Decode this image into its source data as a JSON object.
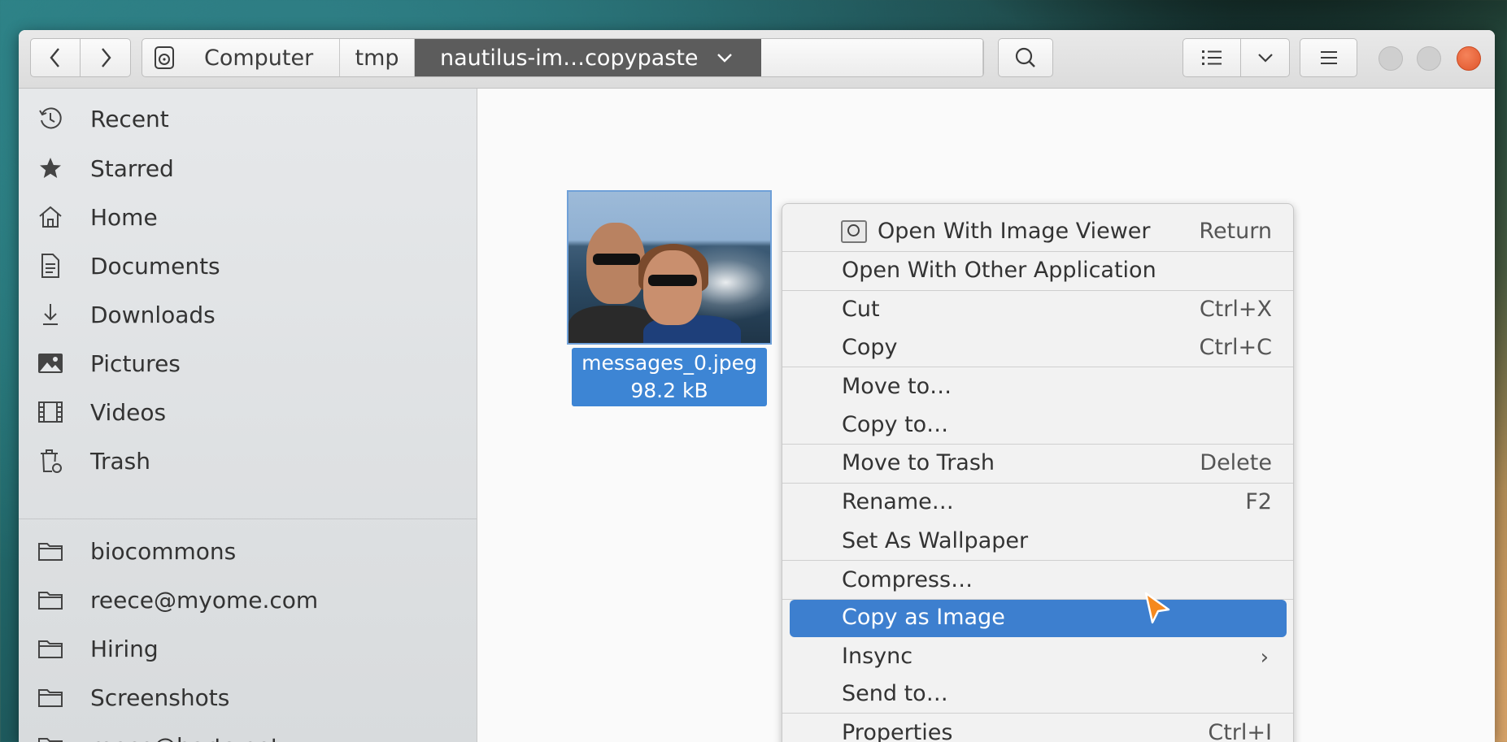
{
  "headerbar": {
    "back_icon": "chevron-left-icon",
    "forward_icon": "chevron-right-icon",
    "path": {
      "root_label": "Computer",
      "root_icon": "disk-icon",
      "crumbs": [
        "tmp"
      ],
      "current": "nautilus-im…copypaste",
      "current_icon": "chevron-down-icon"
    },
    "search_icon": "search-icon",
    "view_icon": "list-view-icon",
    "view_options_icon": "chevron-down-icon",
    "menu_icon": "hamburger-icon",
    "close_color": "#e0552b"
  },
  "sidebar": {
    "places": [
      {
        "label": "Recent",
        "icon": "clock-icon"
      },
      {
        "label": "Starred",
        "icon": "star-icon"
      },
      {
        "label": "Home",
        "icon": "home-icon"
      },
      {
        "label": "Documents",
        "icon": "document-icon"
      },
      {
        "label": "Downloads",
        "icon": "download-icon"
      },
      {
        "label": "Pictures",
        "icon": "pictures-icon"
      },
      {
        "label": "Videos",
        "icon": "video-icon"
      },
      {
        "label": "Trash",
        "icon": "trash-icon"
      }
    ],
    "bookmarks": [
      {
        "label": "biocommons",
        "icon": "folder-icon"
      },
      {
        "label": "reece@myome.com",
        "icon": "folder-icon"
      },
      {
        "label": "Hiring",
        "icon": "folder-icon"
      },
      {
        "label": "Screenshots",
        "icon": "folder-icon"
      },
      {
        "label": "reece@harts.net",
        "icon": "folder-icon"
      }
    ]
  },
  "file": {
    "name": "messages_0.jpeg",
    "size": "98.2 kB"
  },
  "context_menu": {
    "items": [
      {
        "label": "Open With Image Viewer",
        "accel": "Return",
        "icon": "image-viewer-icon"
      },
      {
        "label": "Open With Other Application",
        "accel": ""
      },
      {
        "label": "Cut",
        "accel": "Ctrl+X"
      },
      {
        "label": "Copy",
        "accel": "Ctrl+C"
      },
      {
        "label": "Move to…",
        "accel": ""
      },
      {
        "label": "Copy to…",
        "accel": ""
      },
      {
        "label": "Move to Trash",
        "accel": "Delete"
      },
      {
        "label": "Rename…",
        "accel": "F2"
      },
      {
        "label": "Set As Wallpaper",
        "accel": ""
      },
      {
        "label": "Compress…",
        "accel": ""
      },
      {
        "label": "Copy as Image",
        "accel": "",
        "highlighted": true
      },
      {
        "label": "Insync",
        "accel": "",
        "submenu": true
      },
      {
        "label": "Send to…",
        "accel": ""
      },
      {
        "label": "Properties",
        "accel": "Ctrl+I"
      }
    ],
    "highlight_color": "#3d7fcf"
  }
}
